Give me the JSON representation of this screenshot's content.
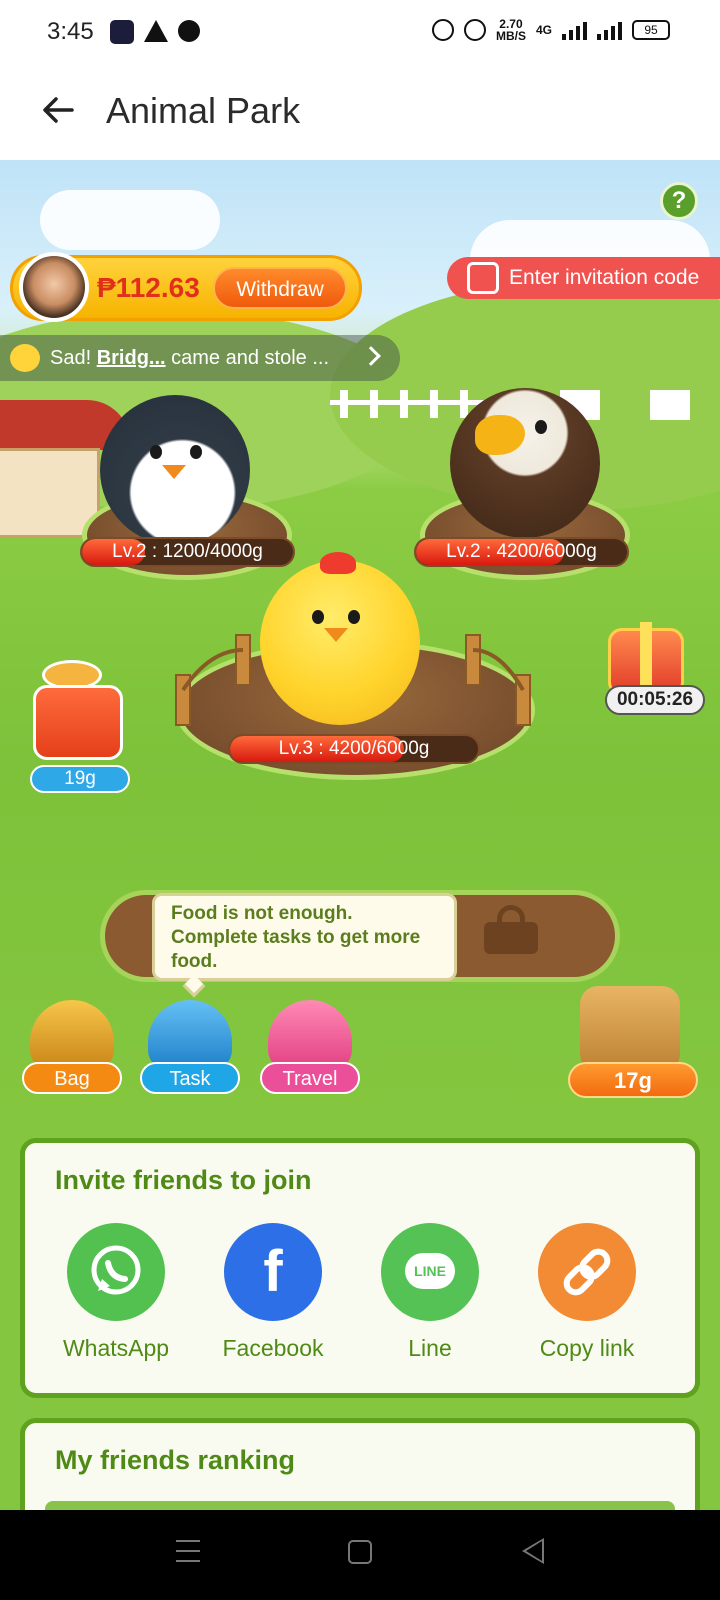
{
  "status_bar": {
    "time": "3:45",
    "speed": "2.70",
    "speed_unit": "MB/S",
    "network": "4G",
    "battery": "95"
  },
  "header": {
    "title": "Animal Park",
    "back_icon": "arrow-left-icon"
  },
  "game": {
    "help_label": "?",
    "balance": "₱112.63",
    "withdraw_label": "Withdraw",
    "invite_code_label": "Enter invitation code",
    "news": {
      "prefix": "Sad! ",
      "name": "Bridg...",
      "suffix": " came and stole ..."
    },
    "animals": [
      {
        "name": "penguin",
        "level_text": "Lv.2 : 1200/4000g",
        "progress": 0.3
      },
      {
        "name": "eagle",
        "level_text": "Lv.2 : 4200/6000g",
        "progress": 0.7
      },
      {
        "name": "chick",
        "level_text": "Lv.3 : 4200/6000g",
        "progress": 0.7
      }
    ],
    "feeder_amount": "19g",
    "gift_timer": "00:05:26",
    "tooltip": "Food is not enough. Complete tasks to get more food.",
    "dock": {
      "bag_label": "Bag",
      "task_label": "Task",
      "travel_label": "Travel",
      "food_amount": "17g"
    }
  },
  "invite": {
    "title": "Invite friends to join",
    "options": [
      {
        "label": "WhatsApp",
        "icon": "whatsapp-icon",
        "color": "#52c150"
      },
      {
        "label": "Facebook",
        "icon": "facebook-icon",
        "color": "#2d6fe6"
      },
      {
        "label": "Line",
        "icon": "line-icon",
        "color": "#55c255"
      },
      {
        "label": "Copy link",
        "icon": "link-icon",
        "color": "#f28b33"
      }
    ],
    "glyphs": {
      "facebook": "f",
      "line": "LINE"
    }
  },
  "ranking": {
    "title": "My friends ranking"
  },
  "colors": {
    "accent_green": "#4f8a17",
    "withdraw_orange": "#f05a0c",
    "invite_red": "#f0524f",
    "balance_red": "#e0301a"
  }
}
